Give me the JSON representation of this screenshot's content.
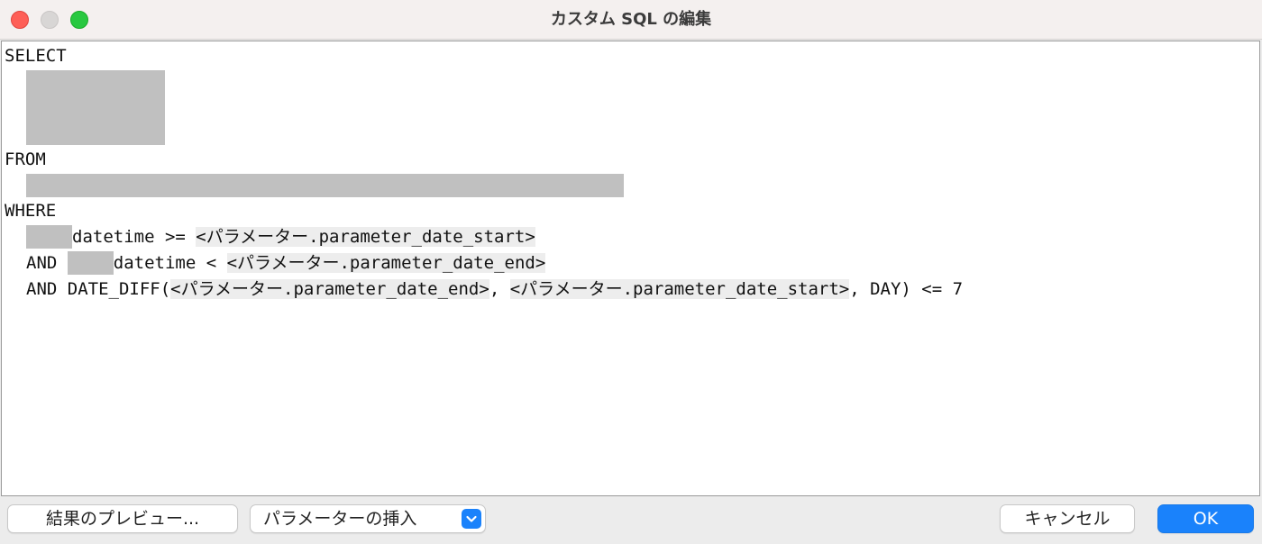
{
  "window": {
    "title": "カスタム SQL の編集"
  },
  "editor": {
    "lines": {
      "select": "SELECT",
      "from": "FROM",
      "where": "WHERE",
      "where1_col": "datetime >= ",
      "where1_param": "<パラメーター.parameter_date_start>",
      "where2_and": "AND ",
      "where2_col": "datetime < ",
      "where2_param": "<パラメーター.parameter_date_end>",
      "where3_and": "AND DATE_DIFF(",
      "where3_param1": "<パラメーター.parameter_date_end>",
      "where3_sep": ", ",
      "where3_param2": "<パラメーター.parameter_date_start>",
      "where3_tail": ", DAY) <= 7"
    }
  },
  "footer": {
    "preview_label": "結果のプレビュー...",
    "insert_param_label": "パラメーターの挿入",
    "cancel_label": "キャンセル",
    "ok_label": "OK"
  },
  "colors": {
    "accent": "#1a82fb",
    "close": "#fe5f57",
    "zoom": "#28c840",
    "redaction": "#c0c0c0"
  }
}
